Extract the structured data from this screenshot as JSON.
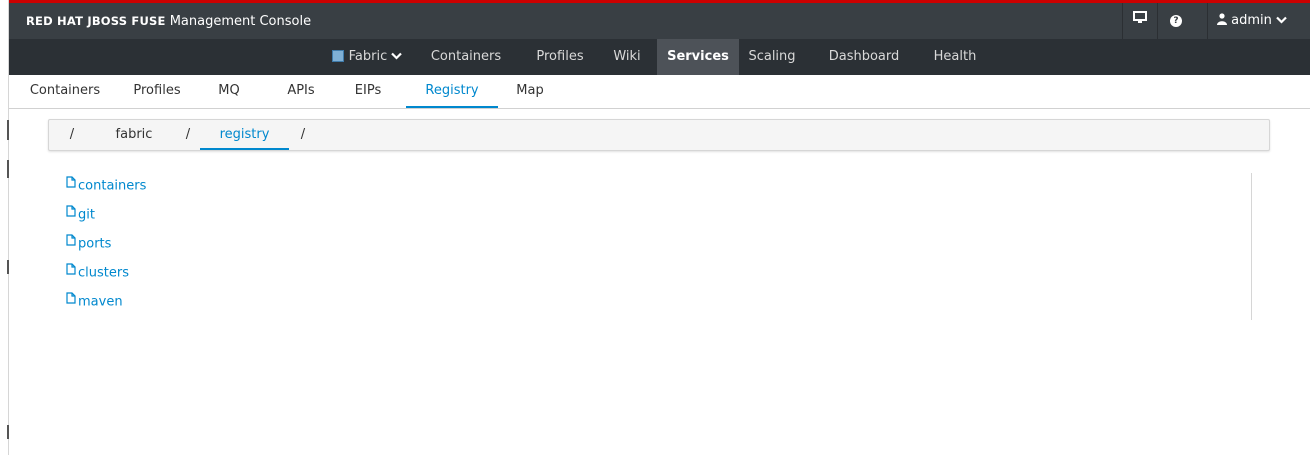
{
  "app": {
    "brand_bold": "RED HAT JBOSS FUSE",
    "brand_rest": "Management Console",
    "user_label": "admin"
  },
  "icons": {
    "monitor": "monitor-icon",
    "help": "question-circle-icon",
    "user": "user-icon",
    "caret": "chevron-down-icon",
    "file": "file-icon"
  },
  "nav": {
    "fabric_label": "Fabric",
    "items": [
      "Containers",
      "Profiles",
      "Wiki",
      "Services",
      "Scaling",
      "Dashboard",
      "Health"
    ],
    "active": "Services"
  },
  "subtabs": {
    "items": [
      "Containers",
      "Profiles",
      "MQ",
      "APIs",
      "EIPs",
      "Registry",
      "Map"
    ],
    "active": "Registry"
  },
  "breadcrumb": {
    "items": [
      "/",
      "fabric",
      "/",
      "registry",
      "/"
    ]
  },
  "files": [
    "containers",
    "git",
    "ports",
    "clusters",
    "maven"
  ],
  "colors": {
    "brand_bar": "#393f44",
    "nav_bar": "#2b3035",
    "nav_active": "#4d5258",
    "accent": "#0088ce",
    "top_accent": "#cc0000"
  }
}
